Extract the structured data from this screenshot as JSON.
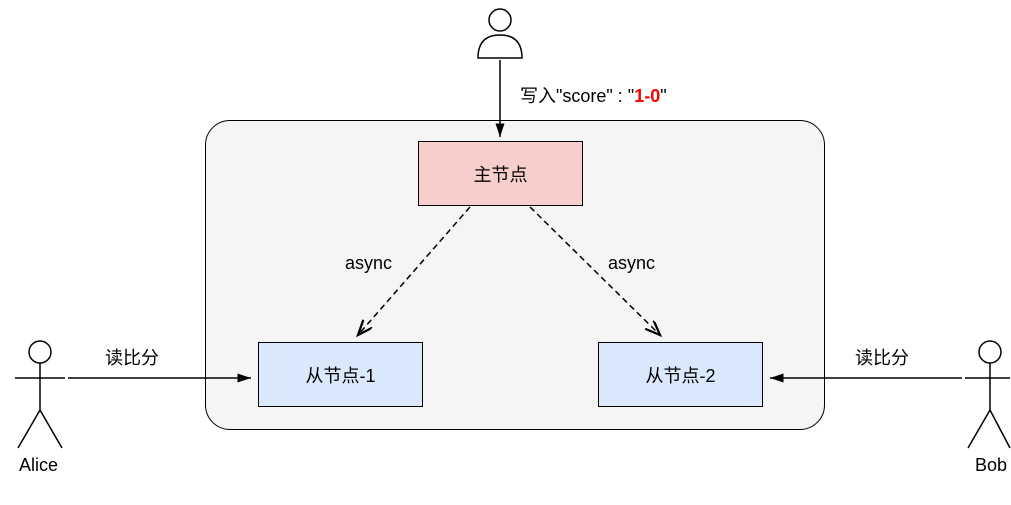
{
  "nodes": {
    "primary": "主节点",
    "follower1": "从节点-1",
    "follower2": "从节点-2"
  },
  "actors": {
    "alice": "Alice",
    "bob": "Bob"
  },
  "labels": {
    "write_prefix": "写入\"score\" : \"",
    "write_value": "1-0",
    "write_suffix": "\"",
    "async1": "async",
    "async2": "async",
    "read1": "读比分",
    "read2": "读比分"
  }
}
